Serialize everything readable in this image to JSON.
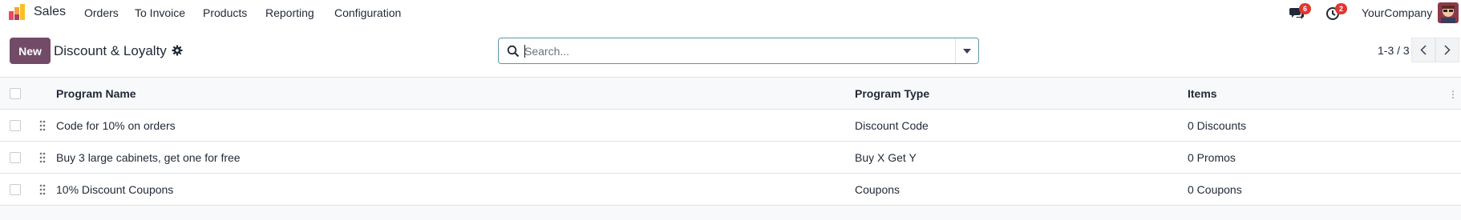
{
  "navbar": {
    "app_name": "Sales",
    "menu": [
      "Orders",
      "To Invoice",
      "Products",
      "Reporting",
      "Configuration"
    ],
    "messages_badge": "6",
    "activities_badge": "2",
    "company": "YourCompany"
  },
  "control_panel": {
    "new_label": "New",
    "title": "Discount & Loyalty",
    "search_placeholder": "Search...",
    "pager": "1-3 / 3"
  },
  "table": {
    "columns": [
      "Program Name",
      "Program Type",
      "Items"
    ],
    "rows": [
      {
        "name": "Code for 10% on orders",
        "type": "Discount Code",
        "items": "0 Discounts"
      },
      {
        "name": "Buy 3 large cabinets, get one for free",
        "type": "Buy X Get Y",
        "items": "0 Promos"
      },
      {
        "name": "10% Discount Coupons",
        "type": "Coupons",
        "items": "0 Coupons"
      }
    ]
  },
  "colors": {
    "primary": "#714b67",
    "badge": "#e4352f",
    "search_border": "#5a9aa8"
  },
  "icons": [
    "app-logo-icon",
    "chat-icon",
    "clock-icon",
    "gear-icon",
    "search-icon",
    "caret-down-icon",
    "chevron-left-icon",
    "chevron-right-icon",
    "drag-handle-icon"
  ]
}
